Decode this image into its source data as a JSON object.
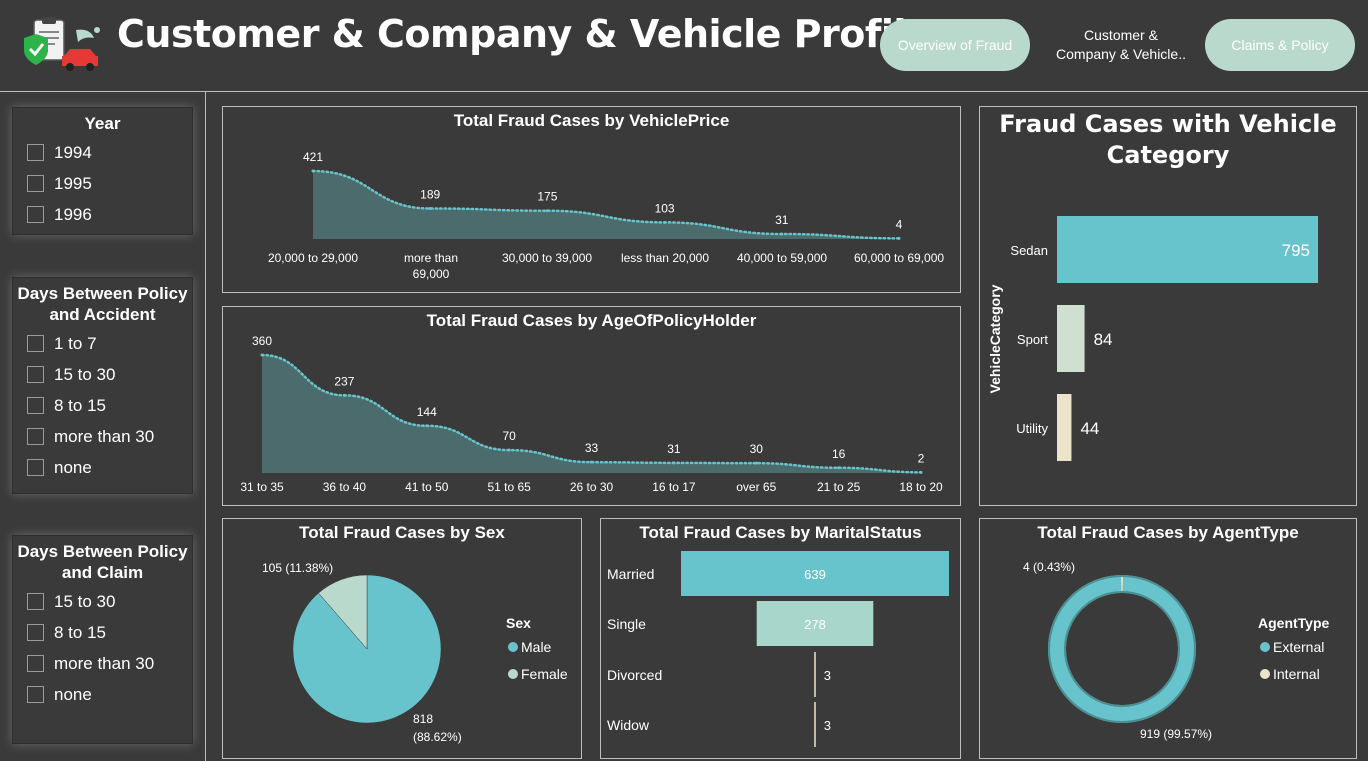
{
  "header": {
    "title": "Customer & Company & Vehicle Profile",
    "nav": {
      "overview": "Overview of Fraud",
      "current_line1": "Customer &",
      "current_line2": "Company & Vehicle..",
      "claims": "Claims & Policy"
    }
  },
  "slicers": {
    "year": {
      "title": "Year",
      "options": [
        "1994",
        "1995",
        "1996"
      ]
    },
    "days_policy_accident": {
      "title_line1": "Days Between Policy",
      "title_line2": "and Accident",
      "options": [
        "1 to 7",
        "15 to 30",
        "8 to 15",
        "more than 30",
        "none"
      ]
    },
    "days_policy_claim": {
      "title_line1": "Days Between Policy",
      "title_line2": "and Claim",
      "options": [
        "15 to 30",
        "8 to 15",
        "more than 30",
        "none"
      ]
    }
  },
  "colors": {
    "teal": "#68c4cc",
    "mint": "#a8d6cb",
    "cream": "#ece4c8",
    "area_fill": "#4c6b6c",
    "panel_bg": "#3a3a3a"
  },
  "chart_data": [
    {
      "id": "vehicle_price",
      "type": "area",
      "title": "Total Fraud Cases by VehiclePrice",
      "categories": [
        "20,000 to 29,000",
        "more than 69,000",
        "30,000 to 39,000",
        "less than 20,000",
        "40,000 to 59,000",
        "60,000 to 69,000"
      ],
      "category_lines": [
        [
          "20,000 to 29,000"
        ],
        [
          "more than",
          "69,000"
        ],
        [
          "30,000 to 39,000"
        ],
        [
          "less than 20,000"
        ],
        [
          "40,000 to 59,000"
        ],
        [
          "60,000 to 69,000"
        ]
      ],
      "values": [
        421,
        189,
        175,
        103,
        31,
        4
      ],
      "ylim": [
        0,
        421
      ]
    },
    {
      "id": "age_policy_holder",
      "type": "area",
      "title": "Total Fraud Cases by AgeOfPolicyHolder",
      "categories": [
        "31 to 35",
        "36 to 40",
        "41 to 50",
        "51 to 65",
        "26 to 30",
        "16 to 17",
        "over 65",
        "21 to 25",
        "18 to 20"
      ],
      "values": [
        360,
        237,
        144,
        70,
        33,
        31,
        30,
        16,
        2
      ],
      "ylim": [
        0,
        360
      ]
    },
    {
      "id": "vehicle_category",
      "type": "bar",
      "title": "Fraud Cases with Vehicle Category",
      "title_line1": "Fraud Cases with Vehicle",
      "title_line2": "Category",
      "ylabel": "VehicleCategory",
      "categories": [
        "Sedan",
        "Sport",
        "Utility"
      ],
      "values": [
        795,
        84,
        44
      ],
      "colors": [
        "#68c4cc",
        "#cfdfd0",
        "#ece4c8"
      ]
    },
    {
      "id": "sex",
      "type": "pie",
      "title": "Total Fraud Cases by Sex",
      "legend_title": "Sex",
      "categories": [
        "Male",
        "Female"
      ],
      "values": [
        818,
        105
      ],
      "labels": [
        "818",
        "105 (11.38%)"
      ],
      "label_pct": [
        "(88.62%)",
        ""
      ],
      "colors": [
        "#68c4cc",
        "#b9d9cc"
      ]
    },
    {
      "id": "marital_status",
      "type": "bar",
      "title": "Total Fraud Cases by MaritalStatus",
      "categories": [
        "Married",
        "Single",
        "Divorced",
        "Widow"
      ],
      "values": [
        639,
        278,
        3,
        3
      ],
      "colors": [
        "#68c4cc",
        "#a8d6cb",
        "#ece4c8",
        "#ece4c8"
      ]
    },
    {
      "id": "agent_type",
      "type": "pie",
      "title": "Total Fraud Cases by AgentType",
      "legend_title": "AgentType",
      "categories": [
        "External",
        "Internal"
      ],
      "values": [
        919,
        4
      ],
      "labels": [
        "919 (99.57%)",
        "4 (0.43%)"
      ],
      "colors": [
        "#68c4cc",
        "#ece4c8"
      ]
    }
  ]
}
